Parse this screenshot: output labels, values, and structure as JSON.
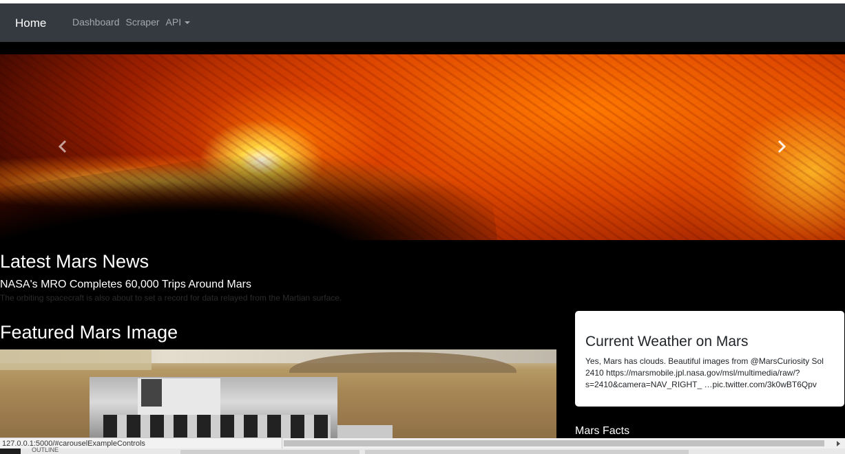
{
  "navbar": {
    "brand": "Home",
    "links": [
      "Dashboard",
      "Scraper",
      "API"
    ]
  },
  "carousel": {
    "prev_icon": "chevron-left-icon",
    "next_icon": "chevron-right-icon"
  },
  "news": {
    "heading": "Latest Mars News",
    "title": "NASA's MRO Completes 60,000 Trips Around Mars",
    "teaser": "The orbiting spacecraft is also about to set a record for data relayed from the Martian surface."
  },
  "featured": {
    "heading": "Featured Mars Image"
  },
  "weather": {
    "title": "Current Weather on Mars",
    "text": "Yes, Mars has clouds. Beautiful images from @MarsCuriosity Sol 2410 https://marsmobile.jpl.nasa.gov/msl/multimedia/raw/?s=2410&camera=NAV_RIGHT_ …pic.twitter.com/3k0wBT6Qpv"
  },
  "facts": {
    "heading": "Mars Facts"
  },
  "status": {
    "url": "127.0.0.1:5000/#carouselExampleControls",
    "outline_label": "OUTLINE"
  },
  "colors": {
    "navbar": "#343a40",
    "page_background": "#000000"
  }
}
